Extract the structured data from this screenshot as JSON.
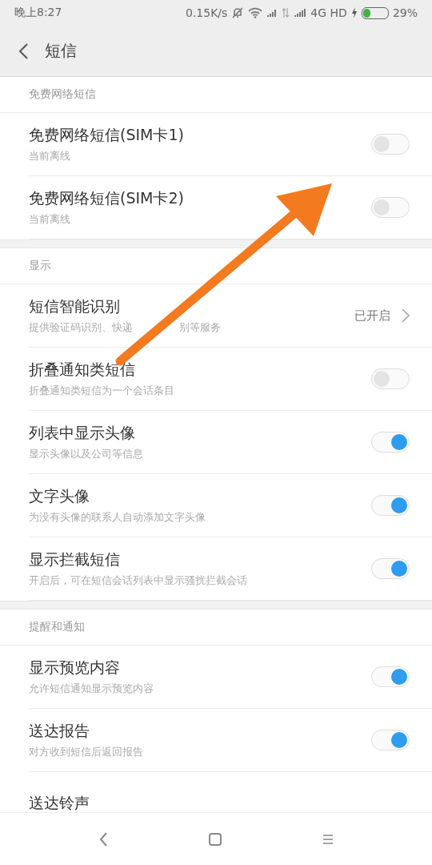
{
  "status_bar": {
    "time": "晚上8:27",
    "speed": "0.15K/s",
    "network": "4G HD",
    "battery": "29%"
  },
  "header": {
    "title": "短信"
  },
  "sections": [
    {
      "title": "免费网络短信",
      "rows": [
        {
          "kind": "toggle",
          "title": "免费网络短信(SIM卡1)",
          "subtitle": "当前离线",
          "on": false
        },
        {
          "kind": "toggle",
          "title": "免费网络短信(SIM卡2)",
          "subtitle": "当前离线",
          "on": false
        }
      ]
    },
    {
      "title": "显示",
      "rows": [
        {
          "kind": "link",
          "title": "短信智能识别",
          "subtitle_parts": [
            "提供验证码识别、快递",
            "别等服务"
          ],
          "value": "已开启"
        },
        {
          "kind": "toggle",
          "title": "折叠通知类短信",
          "subtitle": "折叠通知类短信为一个会话条目",
          "on": false
        },
        {
          "kind": "toggle",
          "title": "列表中显示头像",
          "subtitle": "显示头像以及公司等信息",
          "on": true
        },
        {
          "kind": "toggle",
          "title": "文字头像",
          "subtitle": "为没有头像的联系人自动添加文字头像",
          "on": true
        },
        {
          "kind": "toggle",
          "title": "显示拦截短信",
          "subtitle": "开启后，可在短信会话列表中显示骚扰拦截会话",
          "on": true
        }
      ]
    },
    {
      "title": "提醒和通知",
      "rows": [
        {
          "kind": "toggle",
          "title": "显示预览内容",
          "subtitle": "允许短信通知显示预览内容",
          "on": true
        },
        {
          "kind": "toggle",
          "title": "送达报告",
          "subtitle": "对方收到短信后返回报告",
          "on": true
        },
        {
          "kind": "plain",
          "title": "送达铃声"
        }
      ]
    }
  ],
  "annotation": {
    "kind": "arrow"
  }
}
